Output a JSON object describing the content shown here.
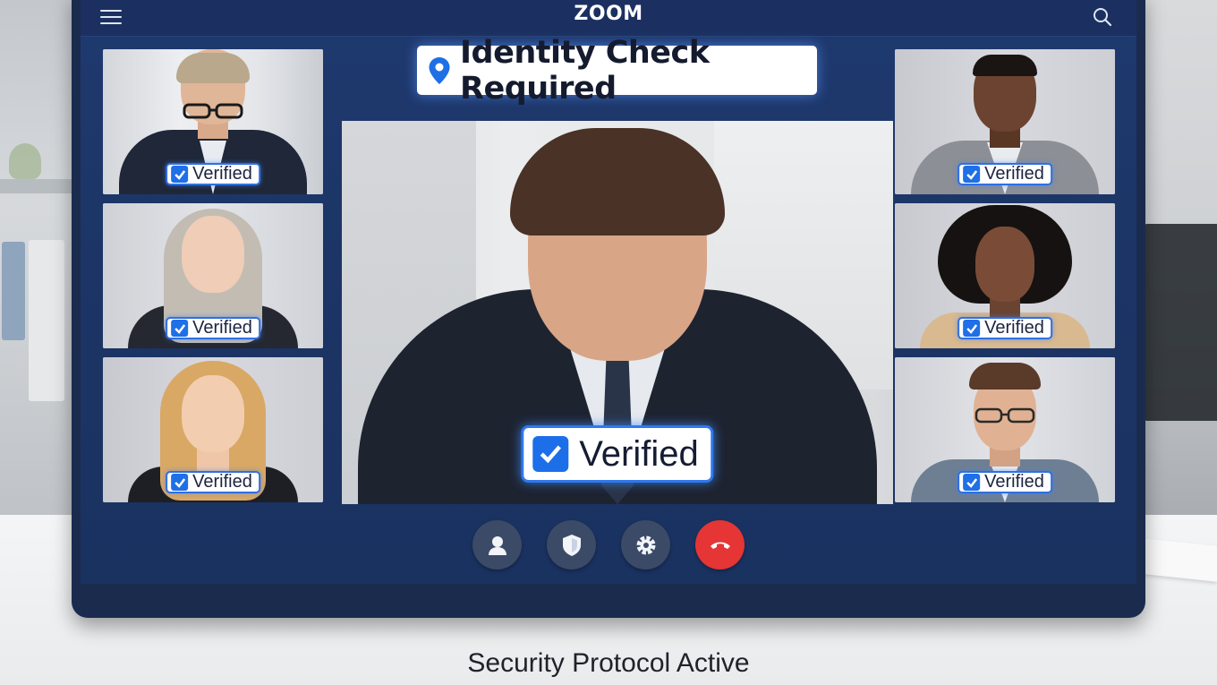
{
  "app": {
    "name": "ZOOM"
  },
  "banner": {
    "text": "Identity Check Required",
    "icon": "location-pin-icon"
  },
  "participants": {
    "left": [
      {
        "badge": "Verified"
      },
      {
        "badge": "Verified"
      },
      {
        "badge": "Verified"
      }
    ],
    "right": [
      {
        "badge": "Verified"
      },
      {
        "badge": "Verified"
      },
      {
        "badge": "Verified"
      }
    ],
    "main": {
      "badge": "Verified"
    }
  },
  "controls": [
    {
      "name": "user-icon"
    },
    {
      "name": "shield-icon"
    },
    {
      "name": "gear-icon"
    },
    {
      "name": "hang-up-icon"
    }
  ],
  "caption": "Security Protocol Active",
  "colors": {
    "accent": "#1f6fe6",
    "hangup": "#e53535",
    "screen": "#1c3566"
  }
}
